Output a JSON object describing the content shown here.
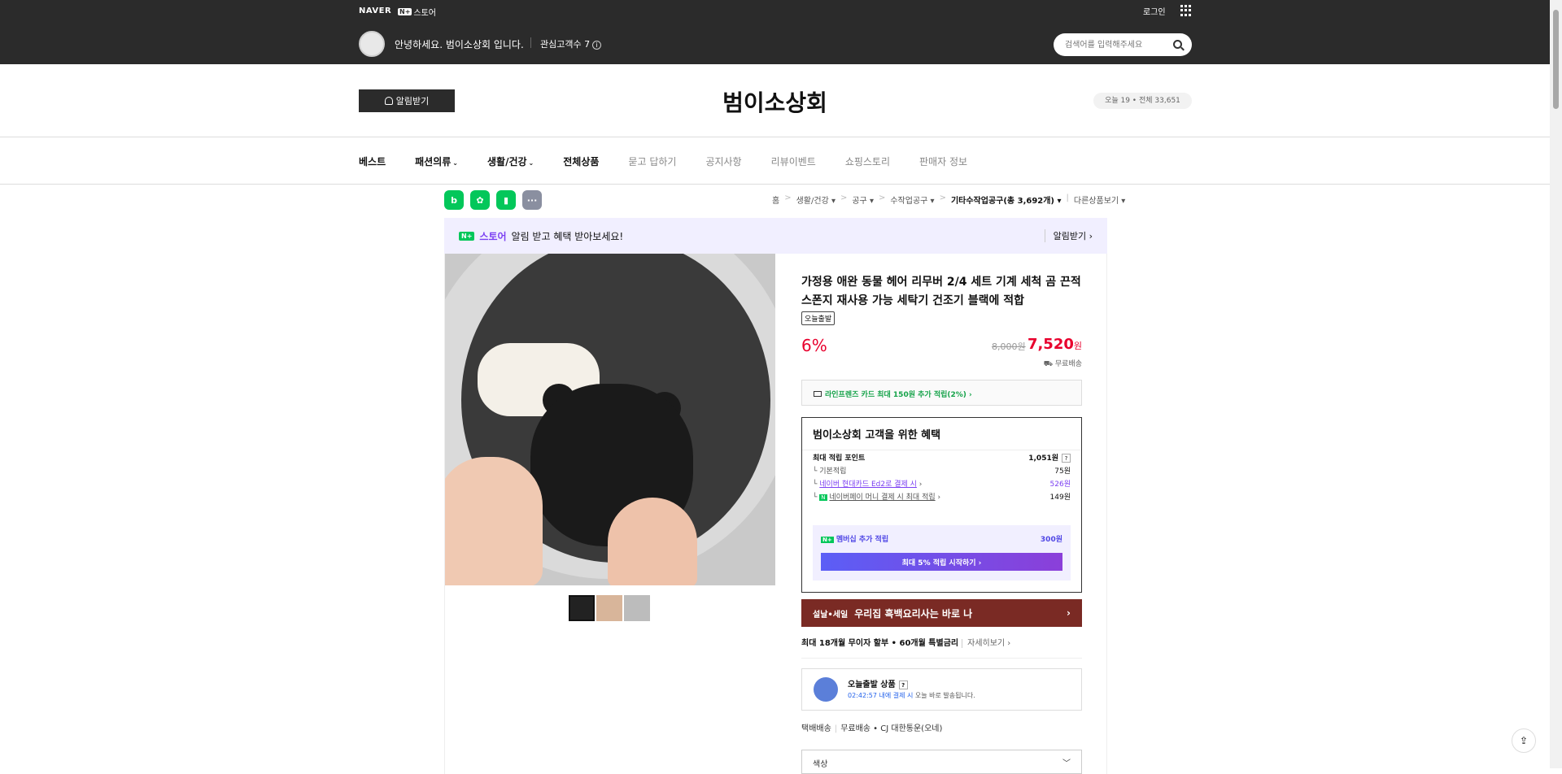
{
  "topbar": {
    "brand": "NAVER",
    "npay_badge": "N+",
    "npay_label": "스토어",
    "login": "로그인",
    "greeting": "안녕하세요. 범이소상회 입니다.",
    "fav_label": "관심고객수 7",
    "search_placeholder": "검색어를 입력해주세요"
  },
  "header": {
    "alarm_button": "알림받기",
    "shop_title": "범이소상회",
    "visit": "오늘 19 • 전체 33,651"
  },
  "nav": {
    "items": [
      "베스트",
      "패션의류",
      "생활/건강",
      "전체상품",
      "묻고 답하기",
      "공지사항",
      "리뷰이벤트",
      "쇼핑스토리",
      "판매자 정보"
    ]
  },
  "breadcrumb": {
    "items": [
      "홈",
      "생활/건강",
      "공구",
      "수작업공구",
      "기타수작업공구(총 3,692개)",
      "다른상품보기"
    ]
  },
  "sns": {
    "items": [
      "b",
      "✿",
      "▮",
      "···"
    ],
    "colors": [
      "#03c75a",
      "#03c75a",
      "#03c75a",
      "#8a8fa0"
    ]
  },
  "promo": {
    "badge": "N+",
    "store": "스토어",
    "text": "알림 받고 혜택 받아보세요!",
    "link": "알림받기"
  },
  "product": {
    "title": "가정용 애완 동물 헤어 리무버 2/4 세트 기계 세척 곰 끈적 스폰지 재사용 가능 세탁기 건조기 블랙에 적합",
    "badge": "오늘출발",
    "discount": "6%",
    "original_price": "8,000원",
    "price": "7,520",
    "price_unit": "원",
    "shipping": "무료배송",
    "card_offer": "라인프렌즈 카드 최대 150원 추가 적립(2%)"
  },
  "benefit": {
    "title": "범이소상회 고객을 위한 혜택",
    "rows": [
      {
        "label": "최대 적립 포인트",
        "value": "1,051원"
      },
      {
        "label": "기본적립",
        "value": "75원"
      },
      {
        "label": "네이버 현대카드 Ed2로 결제 시",
        "value": "526원"
      },
      {
        "label": "네이버페이 머니 결제 시 최대 적립",
        "value": "149원"
      }
    ],
    "membership_label": "멤버십 추가 적립",
    "membership_value": "300원",
    "membership_button": "최대 5% 적립 시작하기"
  },
  "banner": {
    "label": "설날•세일",
    "text": "우리집 흑백요리사는 바로 나"
  },
  "installment": {
    "text": "최대 18개월 무이자 할부 • 60개월 특별금리",
    "more": "자세히보기"
  },
  "today": {
    "title": "오늘출발 상품",
    "time": "02:42:57 내에 결제 시",
    "desc": "오늘 바로 발송됩니다."
  },
  "courier": {
    "label": "택배배송",
    "type": "무료배송",
    "company": "CJ 대한통운(오네)"
  },
  "option": {
    "label": "색상"
  }
}
